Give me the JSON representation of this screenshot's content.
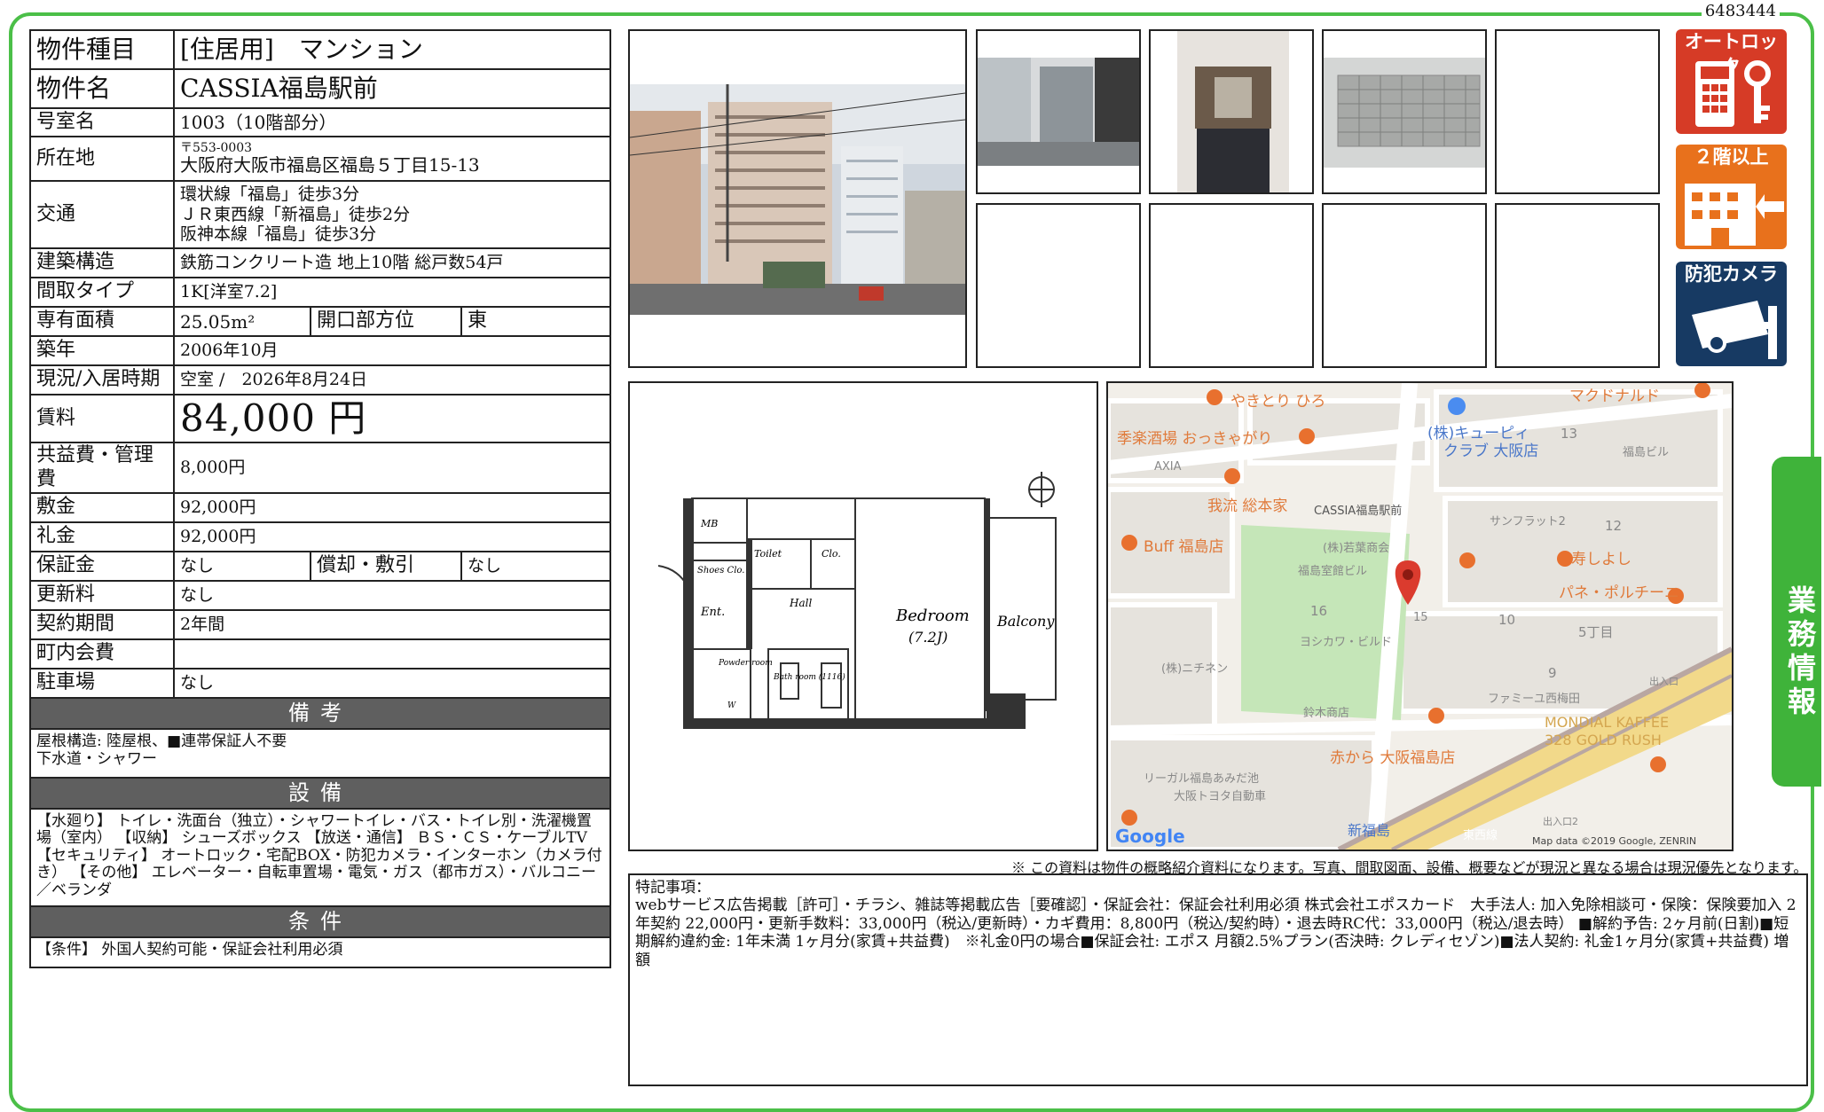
{
  "doc_id": "6483444",
  "property": {
    "type_label": "物件種目",
    "type_value": "[住居用]　マンション",
    "name_label": "物件名",
    "name_value": "CASSIA福島駅前",
    "room_label": "号室名",
    "room_value": "1003（10階部分）",
    "address_label": "所在地",
    "address_zip": "〒553-0003",
    "address_value": "大阪府大阪市福島区福島５丁目15-13",
    "access_label": "交通",
    "access_lines": [
      "環状線「福島」徒歩3分",
      "ＪＲ東西線「新福島」徒歩2分",
      "阪神本線「福島」徒歩3分"
    ],
    "structure_label": "建築構造",
    "structure_value": "鉄筋コンクリート造 地上10階 総戸数54戸",
    "layout_label": "間取タイプ",
    "layout_value": "1K[洋室7.2]",
    "area_label": "専有面積",
    "area_value": "25.05m²",
    "opening_label": "開口部方位",
    "opening_value": "東",
    "built_label": "築年",
    "built_value": "2006年10月",
    "status_label": "現況/入居時期",
    "status_value": "空室 /　2026年8月24日",
    "rent_label": "賃料",
    "rent_value": "84,000 円",
    "fee_label": "共益費・管理費",
    "fee_value": "8,000円",
    "deposit_label": "敷金",
    "deposit_value": "92,000円",
    "key_money_label": "礼金",
    "key_money_value": "92,000円",
    "guarantee_label": "保証金",
    "guarantee_value": "なし",
    "amort_label": "償却・敷引",
    "amort_value": "なし",
    "renewal_label": "更新料",
    "renewal_value": "なし",
    "term_label": "契約期間",
    "term_value": "2年間",
    "town_fee_label": "町内会費",
    "town_fee_value": "",
    "parking_label": "駐車場",
    "parking_value": "なし"
  },
  "remarks": {
    "title": "備考",
    "text": "屋根構造: 陸屋根、■連帯保証人不要\n下水道・シャワー"
  },
  "equipment": {
    "title": "設備",
    "text": "【水廻り】 トイレ・洗面台（独立）・シャワートイレ・バス・トイレ別・洗濯機置場（室内） 【収納】 シューズボックス 【放送・通信】 ＢＳ・ＣＳ・ケーブルTV 【セキュリティ】 オートロック・宅配BOX・防犯カメラ・インターホン（カメラ付き） 【その他】 エレベーター・自転車置場・電気・ガス（都市ガス）・バルコニー／ベランダ"
  },
  "conditions": {
    "title": "条件",
    "text": "【条件】 外国人契約可能・保証会社利用必須"
  },
  "badges": {
    "autolock": "オートロック",
    "floor": "２階以上",
    "camera": "防犯カメラ"
  },
  "floorplan": {
    "mb": "MB",
    "toilet": "Toilet",
    "clo": "Clo.",
    "shoes": "Shoes Clo.",
    "hall": "Hall",
    "ent": "Ent.",
    "bedroom": "Bedroom",
    "bedroom_size": "(7.2J)",
    "balcony": "Balcony",
    "powder": "Powder room",
    "bath": "Bath room (1116)",
    "w": "W"
  },
  "map": {
    "labels": [
      "やきとり ひろ",
      "季楽酒場 おっきゃがり",
      "マクドナルド",
      "(株)キューピィ",
      "クラブ 大阪店",
      "福島ビル",
      "AXIA",
      "我流 総本家",
      "CASSIA福島駅前",
      "サンフラット2",
      "Buff 福島店",
      "(株)若葉商会",
      "寿しよし",
      "福島室館ビル",
      "パネ・ポルチーニ",
      "ヨシカワ・ビルド",
      "5丁目",
      "(株)ニチネン",
      "ファミーユ西梅田",
      "出入口",
      "鈴木商店",
      "MONDIAL KAFFEE",
      "328 GOLD RUSH",
      "赤から 大阪福島店",
      "リーガル福島あみだ池",
      "大阪トヨタ自動車",
      "新福島",
      "東西線",
      "出入口2",
      "Google",
      "Map data ©2019 Google, ZENRIN"
    ],
    "numbers": [
      "13",
      "12",
      "16",
      "15",
      "10",
      "9"
    ]
  },
  "photo_note": "※ この資料は物件の概略紹介資料になります。写真、間取図面、設備、概要などが現況と異なる場合は現況優先となります。",
  "special": {
    "title": "特記事項：",
    "text": "webサービス広告掲載［許可］・チラシ、雑誌等掲載広告［要確認］・保証会社：保証会社利用必須 株式会社エポスカード　大手法人: 加入免除相談可・保険：保険要加入 2年契約 22,000円・更新手数料：33,000円（税込/更新時）・カギ費用：8,800円（税込/契約時）・退去時RC代：33,000円（税込/退去時） ■解約予告: 2ヶ月前(日割)■短期解約違約金: 1年未満 1ヶ月分(家賃+共益費)　※礼金0円の場合■保証会社: エポス 月額2.5%プラン(否決時: クレディセゾン)■法人契約: 礼金1ヶ月分(家賃+共益費) 増額"
  },
  "side_tab": "業務情報"
}
